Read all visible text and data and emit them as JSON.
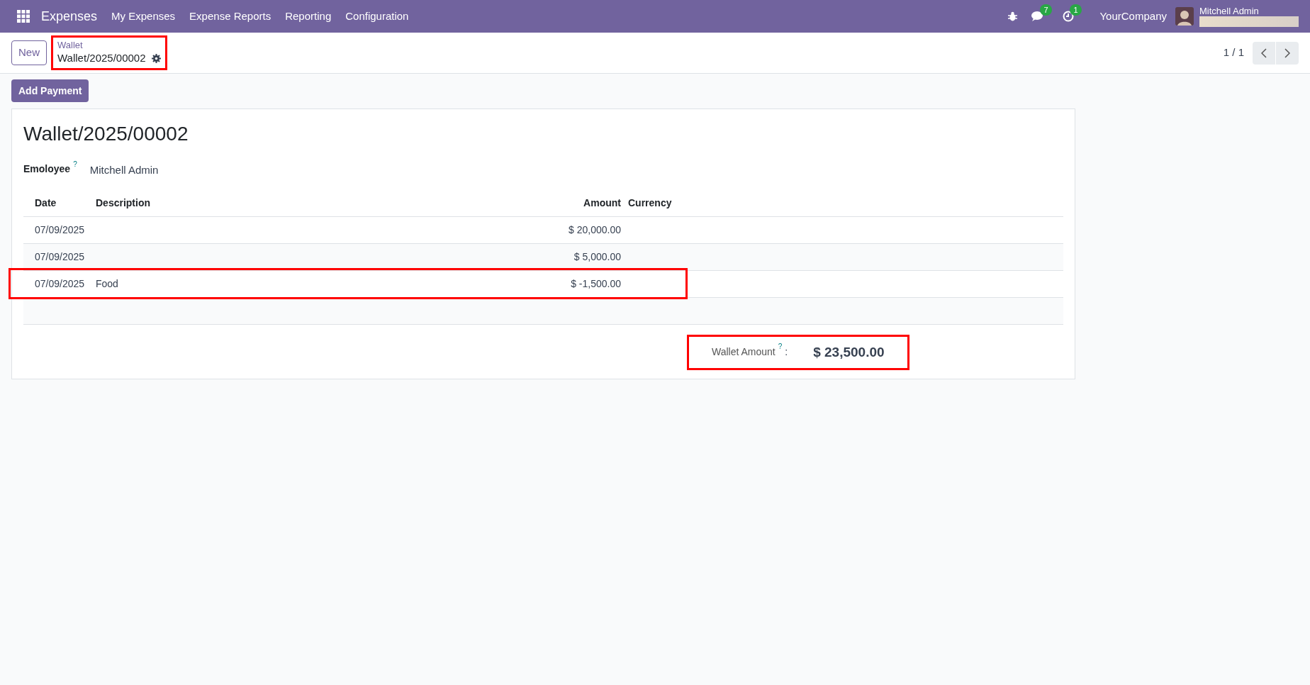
{
  "navbar": {
    "app_name": "Expenses",
    "menu": [
      "My Expenses",
      "Expense Reports",
      "Reporting",
      "Configuration"
    ],
    "messages_count": "7",
    "activities_count": "1",
    "company": "YourCompany",
    "user": "Mitchell Admin"
  },
  "control_panel": {
    "new_button": "New",
    "breadcrumb_parent": "Wallet",
    "breadcrumb_current": "Wallet/2025/00002",
    "breadcrumb_highlighted": true,
    "pager": "1 / 1"
  },
  "action_button": "Add Payment",
  "form": {
    "title": "Wallet/2025/00002",
    "employee_label": "Emoloyee",
    "employee_help": "?",
    "employee_value": "Mitchell Admin",
    "table": {
      "columns": [
        "Date",
        "Description",
        "Amount",
        "Currency"
      ],
      "rows": [
        {
          "date": "07/09/2025",
          "description": "",
          "amount": "$ 20,000.00",
          "highlighted": false
        },
        {
          "date": "07/09/2025",
          "description": "",
          "amount": "$ 5,000.00",
          "highlighted": false
        },
        {
          "date": "07/09/2025",
          "description": "Food",
          "amount": "$ -1,500.00",
          "highlighted": true
        }
      ]
    },
    "total": {
      "label": "Wallet Amount",
      "help": "?",
      "separator": ":",
      "value": "$ 23,500.00",
      "highlighted": true
    }
  }
}
